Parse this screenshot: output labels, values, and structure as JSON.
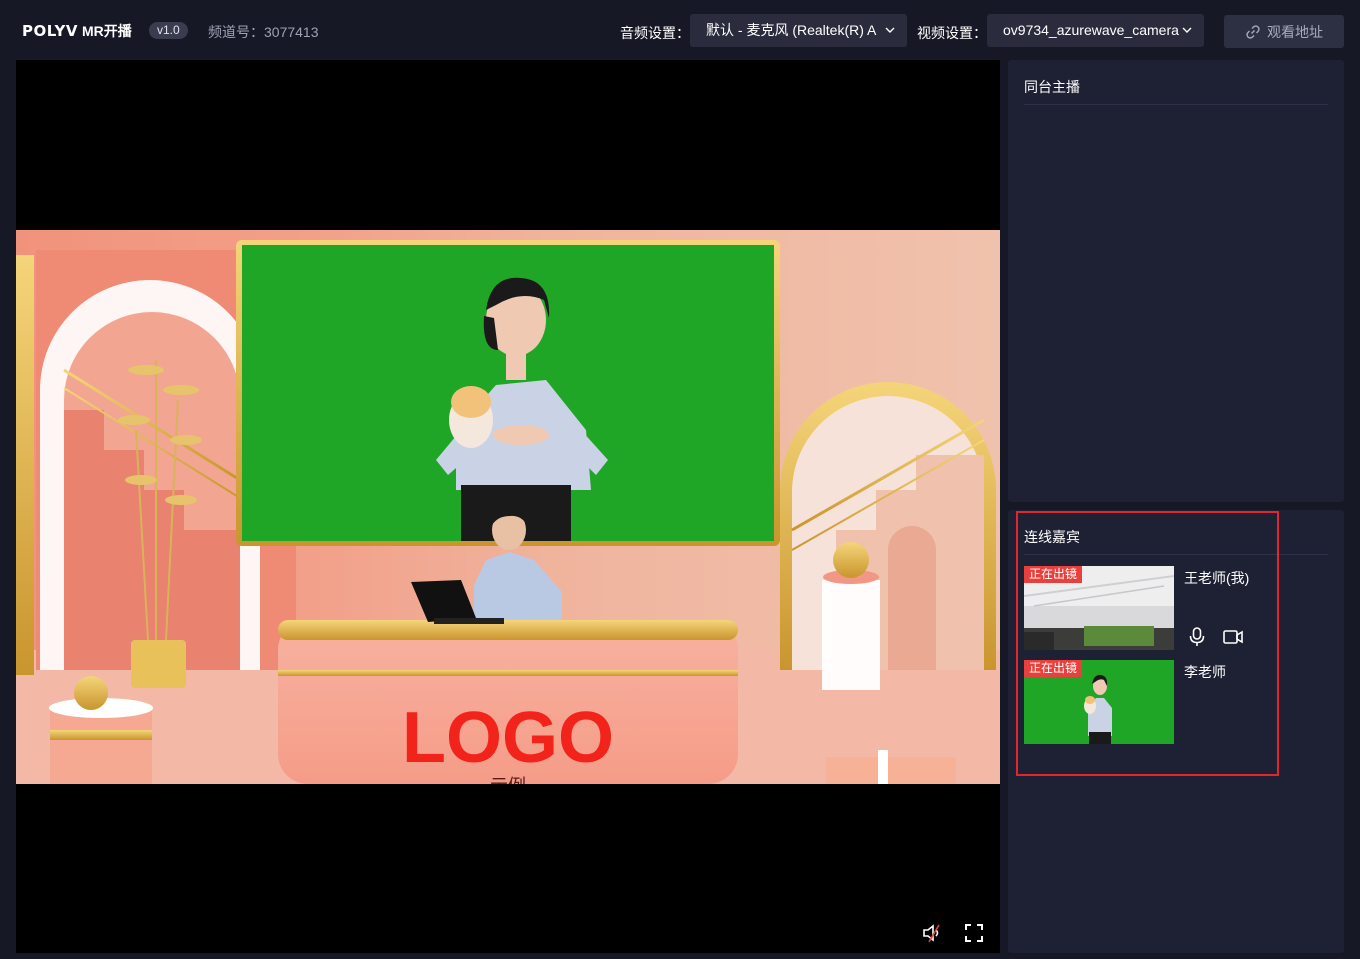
{
  "header": {
    "brand": "POLYV",
    "product": "MR开播",
    "version": "v1.0",
    "channel_text": "频道号：3077413",
    "audio_label": "音频设置：",
    "audio_value": "默认 - 麦克风 (Realtek(R) A",
    "video_label": "视频设置：",
    "video_value": "ov9734_azurewave_camera",
    "watch_link_label": "观看地址"
  },
  "stage": {
    "desk_logo_text": "LOGO",
    "desk_sub_text": "示例"
  },
  "cohost_panel": {
    "title": "同台主播"
  },
  "guest_panel": {
    "title": "连线嘉宾",
    "guests": [
      {
        "name": "王老师(我)",
        "badge": "正在出镜"
      },
      {
        "name": "李老师",
        "badge": "正在出镜"
      }
    ]
  },
  "colors": {
    "accent_red": "#e8403c",
    "highlight_border": "#e0262f",
    "panel_bg": "#1e2034",
    "page_bg": "#171826",
    "green_screen": "#1fa627"
  }
}
